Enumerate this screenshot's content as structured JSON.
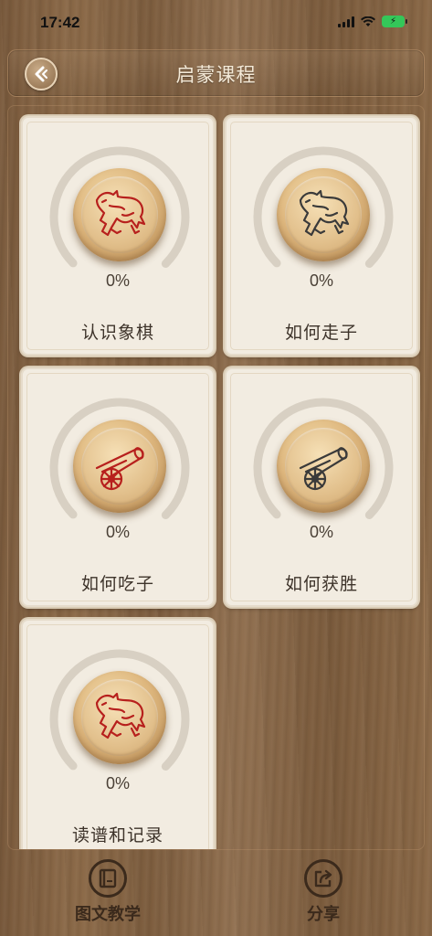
{
  "status_bar": {
    "time": "17:42"
  },
  "header": {
    "title": "启蒙课程",
    "back_icon": "back-arrow-icon"
  },
  "colors": {
    "red_piece": "#b7201d",
    "black_piece": "#3a3a3a",
    "card_bg": "#f2ece1",
    "wood": "#86654a"
  },
  "lessons": [
    {
      "title": "认识象棋",
      "progress": "0%",
      "icon": "horse-icon",
      "piece_color": "red"
    },
    {
      "title": "如何走子",
      "progress": "0%",
      "icon": "horse-icon",
      "piece_color": "black"
    },
    {
      "title": "如何吃子",
      "progress": "0%",
      "icon": "cannon-icon",
      "piece_color": "red"
    },
    {
      "title": "如何获胜",
      "progress": "0%",
      "icon": "cannon-icon",
      "piece_color": "black"
    },
    {
      "title": "读谱和记录",
      "progress": "0%",
      "icon": "horse-icon",
      "piece_color": "red"
    }
  ],
  "bottom_tabs": [
    {
      "label": "图文教学",
      "icon": "book-icon"
    },
    {
      "label": "分享",
      "icon": "share-icon"
    }
  ]
}
